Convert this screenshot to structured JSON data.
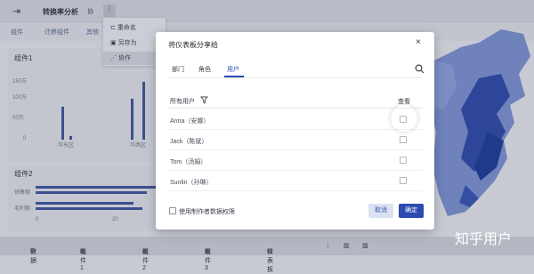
{
  "topbar": {
    "back_icon": "exit-icon",
    "report_name": "转换率分析",
    "edit_label": "协",
    "more_label": "⋮"
  },
  "toolbar": {
    "items": [
      "组件",
      "迁移组件",
      "其他"
    ]
  },
  "menu": {
    "items": [
      "重命名",
      "另存为",
      "协作"
    ]
  },
  "panel1": {
    "title": "组件1",
    "y_ticks": [
      "150万",
      "100万",
      "50万",
      "0"
    ],
    "x_labels": [
      "华东区",
      "华西区"
    ]
  },
  "panel2": {
    "title": "组件2",
    "y_labels": [
      "销售额",
      "毛利额"
    ],
    "x_ticks": [
      "0",
      "20"
    ]
  },
  "bottom_tabs": {
    "items": [
      "数据",
      "组件1",
      "组件2",
      "组件3",
      "仪表板"
    ]
  },
  "watermark": "知乎用户",
  "dialog": {
    "title": "将仪表板分享给",
    "tabs": [
      "部门",
      "角色",
      "用户"
    ],
    "active_tab": "用户",
    "col_users": "所有用户",
    "col_view": "查看",
    "users": [
      "Anna（安娜）",
      "Jack（陈斌）",
      "Tom（汤姆）",
      "Sunlin（孙琳）"
    ],
    "use_creator_permission": "使用制作者数据权限",
    "cancel": "取消",
    "confirm": "确定"
  },
  "colors": {
    "primary": "#2c4bb0",
    "bar": "#3c4f8f",
    "map_dark": "#1f3a8a"
  }
}
